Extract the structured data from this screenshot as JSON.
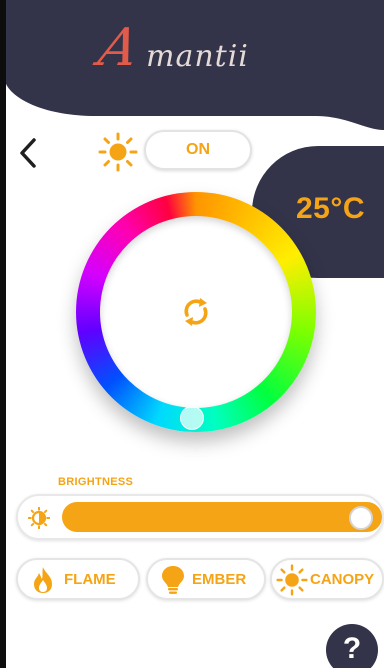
{
  "header": {
    "logo_initial": "A",
    "logo_rest": "mantii",
    "background_color": "#33334a",
    "logo_color": "#e05b49"
  },
  "controls": {
    "back_icon": "chevron-left-icon",
    "sun_icon": "sun-icon",
    "power_label": "ON"
  },
  "temperature": {
    "value": "25°C"
  },
  "color_wheel": {
    "center_icon": "cycle-icon",
    "accent_color": "#f5a415"
  },
  "brightness": {
    "label": "BRIGHTNESS",
    "icon": "brightness-icon",
    "level_fraction": 1.0
  },
  "modes": [
    {
      "label": "FLAME",
      "icon": "flame-icon"
    },
    {
      "label": "EMBER",
      "icon": "bulb-icon"
    },
    {
      "label": "CANOPY",
      "icon": "sun-icon"
    }
  ],
  "help": {
    "label": "?"
  }
}
